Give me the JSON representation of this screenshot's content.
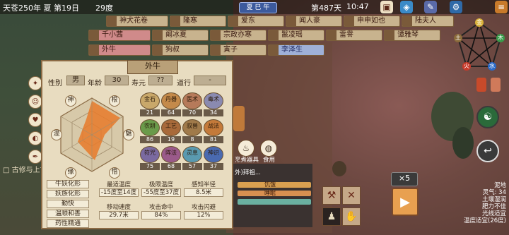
{
  "topbar": {
    "date": "天苍250年 夏 第19日",
    "temperature": "29度",
    "season_badge": "夏 巳 午",
    "day_count": "第487天",
    "time": "10:47"
  },
  "names_row1": [
    "神犬花卷",
    "隆寒",
    "爱东",
    "闻人豪",
    "申申如也",
    "陆夫人"
  ],
  "names_row2": [
    "千小茜",
    "阚冰夏",
    "宗政亦寒",
    "鬣凌瑶",
    "雷譽",
    "谭雅琴"
  ],
  "names_row3": [
    "外牛",
    "狗叔",
    "寅子",
    "李泽生"
  ],
  "panel": {
    "title": "外牛",
    "gender_label": "性别",
    "gender_value": "男",
    "age_label": "年龄",
    "age_value": "30",
    "lifespan_label": "寿元",
    "lifespan_value": "??",
    "path_label": "道行",
    "path_value": "-",
    "hex_labels": [
      "神",
      "根",
      "魅",
      "悟",
      "缘",
      "混"
    ],
    "skills": [
      {
        "name": "金石",
        "value": "21",
        "color": "#c9a86a"
      },
      {
        "name": "丹器",
        "value": "64",
        "color": "#c48a4a"
      },
      {
        "name": "医术",
        "value": "70",
        "color": "#b67a5a"
      },
      {
        "name": "毒术",
        "value": "34",
        "color": "#8a8ab0"
      },
      {
        "name": "农耕",
        "value": "86",
        "color": "#6a9a4a"
      },
      {
        "name": "工艺",
        "value": "19",
        "color": "#a86a3a"
      },
      {
        "name": "驭兽",
        "value": "8",
        "color": "#a07a4a"
      },
      {
        "name": "战法",
        "value": "81",
        "color": "#c47a3a"
      },
      {
        "name": "符咒",
        "value": "75",
        "color": "#7a6aa0"
      },
      {
        "name": "阵法",
        "value": "68",
        "color": "#9a5a8a"
      },
      {
        "name": "灵息",
        "value": "57",
        "color": "#5a9ab0"
      },
      {
        "name": "神识",
        "value": "37",
        "color": "#4a6ab0"
      }
    ],
    "traits": [
      "牛妖化形",
      "妖族化形",
      "勤快",
      "温顺和善",
      "药性精通"
    ],
    "stats": [
      {
        "label": "最适温度",
        "value": "-15度至14度"
      },
      {
        "label": "极限温度",
        "value": "-55度至37度"
      },
      {
        "label": "感知半径",
        "value": "8.5米"
      },
      {
        "label": "移动速度",
        "value": "29.7米"
      },
      {
        "label": "攻击命中",
        "value": "84%"
      },
      {
        "label": "攻击闪避",
        "value": "12%"
      }
    ]
  },
  "side_note": "古修与上古之",
  "bottom_left": "□ 古修与上古之戒",
  "action_labels": {
    "cook": "烹煮器具",
    "eat": "食用"
  },
  "progress": {
    "bar1_label": "饥饿",
    "bar2_label": "睡眠",
    "title": "外)拜祖..."
  },
  "speed_badge": "×5",
  "right_info": [
    "泥地",
    "灵气: 34",
    "土壤湿润",
    "肥力不佳",
    "光线适宜",
    "温度适宜(26度)"
  ],
  "elements": [
    "土",
    "木",
    "火",
    "水",
    "金"
  ],
  "colors": {
    "accent": "#e87a2a",
    "hex_fill": "#e87a2a"
  }
}
